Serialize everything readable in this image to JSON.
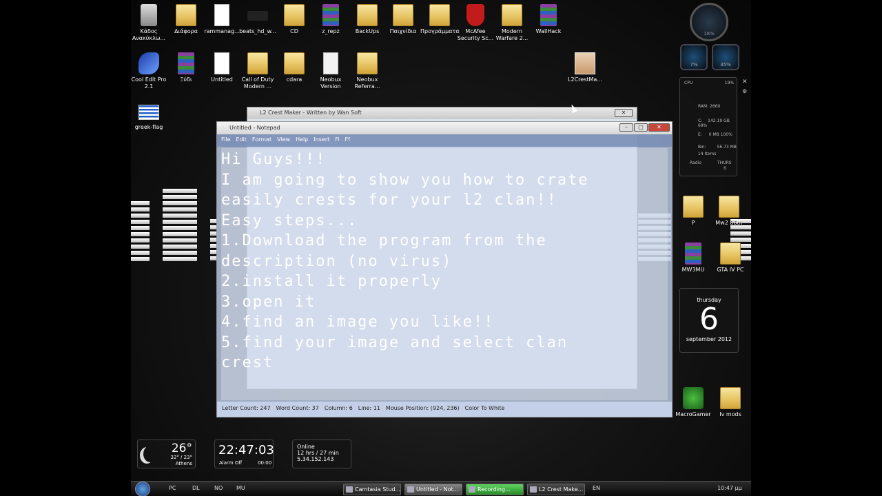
{
  "desktop_icons": [
    {
      "label": "Κάδος Ανακύκλω...",
      "icon": "recycle-bin-icon"
    },
    {
      "label": "Διάφορα",
      "icon": "folder-icon"
    },
    {
      "label": "rammanag...",
      "icon": "document-icon"
    },
    {
      "label": "beats_hd_w...",
      "icon": "beats-icon"
    },
    {
      "label": "CD",
      "icon": "folder-icon"
    },
    {
      "label": "z_repz",
      "icon": "archive-icon"
    },
    {
      "label": "BackUps",
      "icon": "folder-icon"
    },
    {
      "label": "Παιχνίδια",
      "icon": "folder-icon"
    },
    {
      "label": "Προγράμματα",
      "icon": "folder-icon"
    },
    {
      "label": "McAfee Security Sc...",
      "icon": "mcafee-icon"
    },
    {
      "label": "Modern Warfare 2...",
      "icon": "folder-icon"
    },
    {
      "label": "WallHack",
      "icon": "archive-icon"
    },
    {
      "label": "Cool Edit Pro 2.1",
      "icon": "cool-edit-icon"
    },
    {
      "label": "Ξύδι",
      "icon": "archive-icon"
    },
    {
      "label": "Untitled",
      "icon": "document-icon"
    },
    {
      "label": "Call of Duty Modern ...",
      "icon": "folder-icon"
    },
    {
      "label": "cdara",
      "icon": "folder-icon"
    },
    {
      "label": "Neobux Version",
      "icon": "document-icon"
    },
    {
      "label": "Neobux Referra...",
      "icon": "folder-icon"
    },
    {
      "label": "L2CrestMa...",
      "icon": "image-icon"
    },
    {
      "label": "greek-flag",
      "icon": "greek-flag-icon"
    },
    {
      "label": "P",
      "icon": "folder-icon"
    },
    {
      "label": "Mw2 86th",
      "icon": "folder-icon"
    },
    {
      "label": "MW3MU",
      "icon": "archive-icon"
    },
    {
      "label": "GTA IV PC",
      "icon": "folder-icon"
    },
    {
      "label": "MacroGamer",
      "icon": "macrogamer-icon"
    },
    {
      "label": "Iv mods",
      "icon": "folder-icon"
    }
  ],
  "background_window": {
    "title": "L2 Crest Maker - Written by Wan Soft"
  },
  "notepad": {
    "title": "Untitled - Notepad",
    "menu": [
      "File",
      "Edit",
      "Format",
      "View",
      "Help",
      "Insert",
      "Fi",
      "Ff"
    ],
    "content": "Hi Guys!!!\nI am going to show you how to crate\neasily crests for your l2 clan!!\nEasy steps...\n1.Download the program from the\ndescription (no virus)\n2.install it properly\n3.open it\n4.find an image you like!!\n5.find your image and select clan\ncrest",
    "status": {
      "letters": "Letter Count: 247",
      "words": "Word Count: 37",
      "column": "Column: 6",
      "line": "Line: 11",
      "mouse": "Mouse Position: (924, 236)",
      "color": "Color To White"
    }
  },
  "sysmon": {
    "cpu_label": "CPU",
    "cpu_value": "19%",
    "ram": "RAM: 2660",
    "drive_c_label": "C:",
    "drive_c": "142.19 GB 69%",
    "drive_e_label": "E:",
    "drive_e": "0 MB 100%",
    "bin_label": "Bin:",
    "bin": "56.73 MB",
    "bin_items": "14 Items",
    "radio": "Radio",
    "day": "THURS",
    "date": "6",
    "gauge_value": "18%",
    "gauge_small_1": "7%",
    "gauge_small_2": "35%"
  },
  "calendar": {
    "day_name": "thursday",
    "day": "6",
    "month_year": "september 2012"
  },
  "weather": {
    "temp": "26°",
    "range": "32° / 23°",
    "city": "Athens"
  },
  "clock": {
    "time": "22:47:03",
    "alarm": "Alarm Off",
    "alarm_time": "00:00"
  },
  "network": {
    "status": "Online",
    "uptime": "12 hrs / 27 min",
    "ip": "5.34.152.143"
  },
  "taskbar": {
    "quick": [
      "PC",
      "DL",
      "NO",
      "MU"
    ],
    "items": [
      "Camtasia Stud...",
      "Untitled - Not...",
      "Recording...",
      "L2 Crest Make..."
    ],
    "lang": "EN",
    "time": "10:47 μμ"
  },
  "colors": {
    "recording_green": "#3fae3f",
    "notepad_menu": "#7a8cb4"
  }
}
